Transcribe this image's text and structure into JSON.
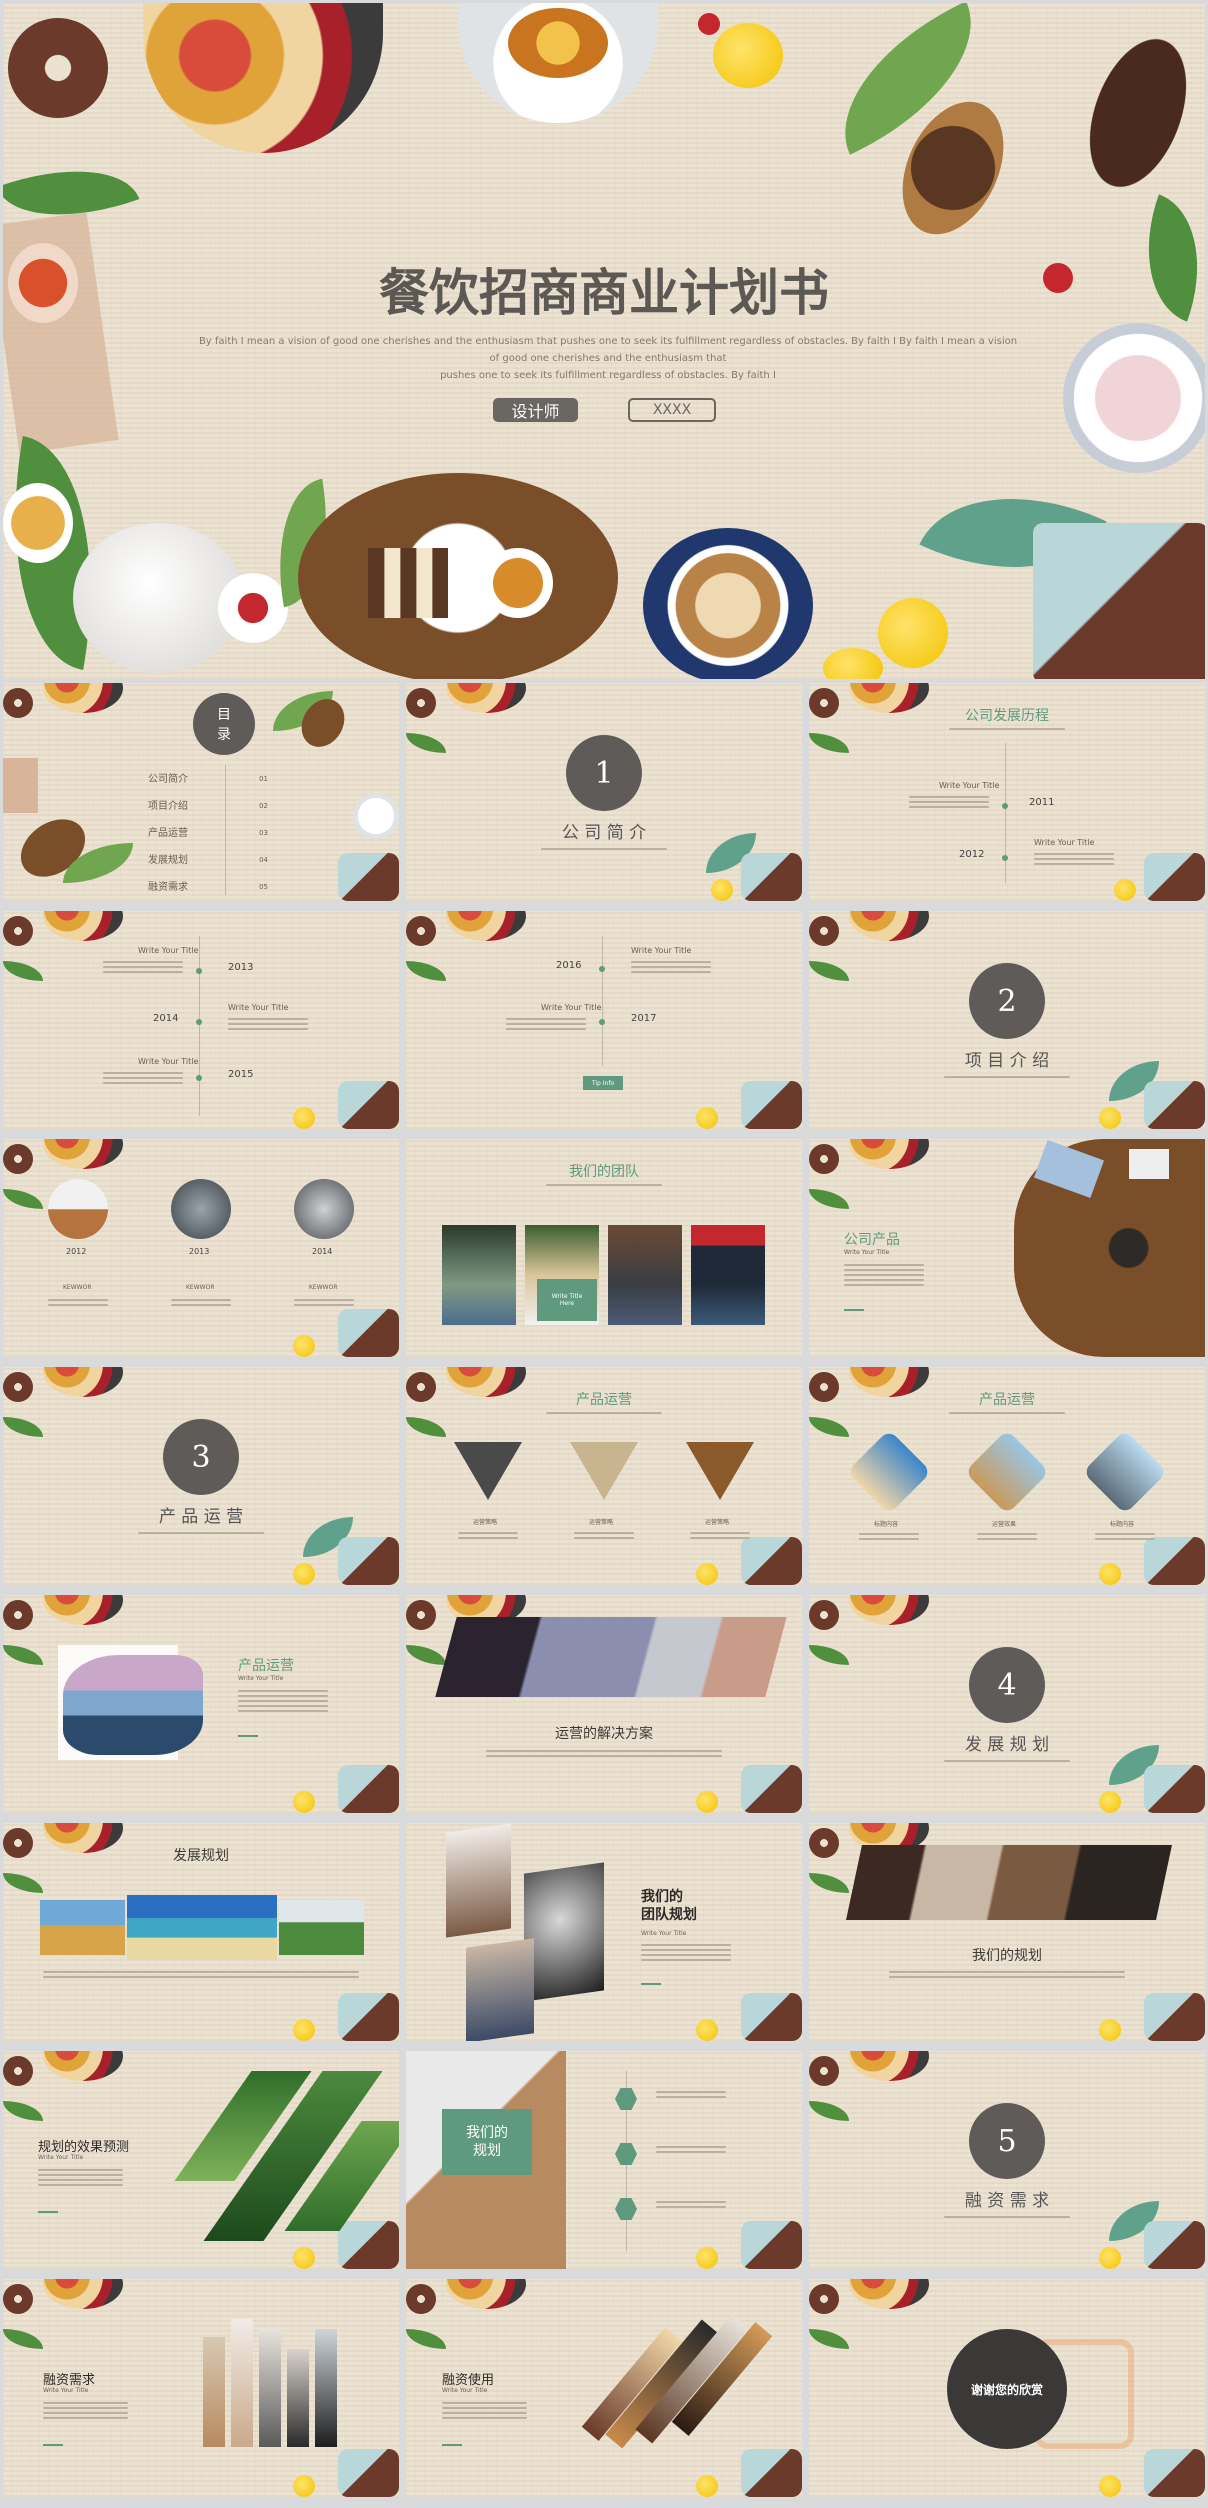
{
  "hero": {
    "title": "餐饮招商商业计划书",
    "subtitle_line1": "By faith I mean a vision of good one cherishes and the enthusiasm that pushes one to seek its fulfillment regardless of obstacles. By faith I By faith I mean a vision of good one cherishes and the enthusiasm that",
    "subtitle_line2": "pushes one to seek its fulfillment regardless of obstacles. By faith I",
    "designer_button": "设计师",
    "xxxx_button": "XXXX"
  },
  "toc": {
    "title_top": "目",
    "title_bottom": "录",
    "items": [
      {
        "label": "公司简介",
        "num": "01"
      },
      {
        "label": "项目介绍",
        "num": "02"
      },
      {
        "label": "产品运营",
        "num": "03"
      },
      {
        "label": "发展规划",
        "num": "04"
      },
      {
        "label": "融资需求",
        "num": "05"
      }
    ]
  },
  "section1": {
    "num": "1",
    "title": "公 司 简 介"
  },
  "history": {
    "title": "公司发展历程",
    "write": "Write Your Title",
    "y2011": "2011",
    "y2012": "2012"
  },
  "timeline_a": {
    "write": "Write Your Title",
    "y2013": "2013",
    "y2014": "2014",
    "y2015": "2015"
  },
  "timeline_b": {
    "write": "Write Your Title",
    "y2016": "2016",
    "y2017": "2017",
    "tag": "Tip Info"
  },
  "section2": {
    "num": "2",
    "title": "项 目 介 绍"
  },
  "milestones": {
    "y1": "2012",
    "y2": "2013",
    "y3": "2014",
    "c1": "KEWWOR",
    "c2": "KEWWOR",
    "c3": "KEWWOR"
  },
  "team": {
    "title": "我们的团队",
    "tag_line1": "Write Title",
    "tag_line2": "Here"
  },
  "product": {
    "title": "公司产品",
    "write": "Write Your Title"
  },
  "section3": {
    "num": "3",
    "title": "产 品 运 营"
  },
  "ops_a": {
    "title": "产品运营",
    "cap": "运营策略"
  },
  "ops_b": {
    "title": "产品运营",
    "cap1": "标题内容",
    "cap2": "运营效果",
    "cap3": "标题内容"
  },
  "ops_c": {
    "title": "产品运营",
    "write": "Write Your Title"
  },
  "solution": {
    "title": "运营的解决方案"
  },
  "section4": {
    "num": "4",
    "title": "发 展 规 划"
  },
  "plan": {
    "title": "发展规划"
  },
  "team_plan": {
    "title_line1": "我们的",
    "title_line2": "团队规划",
    "write": "Write Your Title"
  },
  "our_plan": {
    "title": "我们的规划"
  },
  "forecast": {
    "title": "规划的效果预测",
    "write": "Write Your Title"
  },
  "plan_box": {
    "line1": "我们的",
    "line2": "规划"
  },
  "section5": {
    "num": "5",
    "title": "融 资 需 求"
  },
  "funding": {
    "title": "融资需求",
    "write": "Write Your Title"
  },
  "usage": {
    "title": "融资使用",
    "write": "Write Your Title"
  },
  "thanks": {
    "text": "谢谢您的欣赏"
  },
  "colors": {
    "accent_green": "#5f9a7f",
    "dark_gray": "#5e5b58",
    "wood": "#ebe1d0"
  }
}
